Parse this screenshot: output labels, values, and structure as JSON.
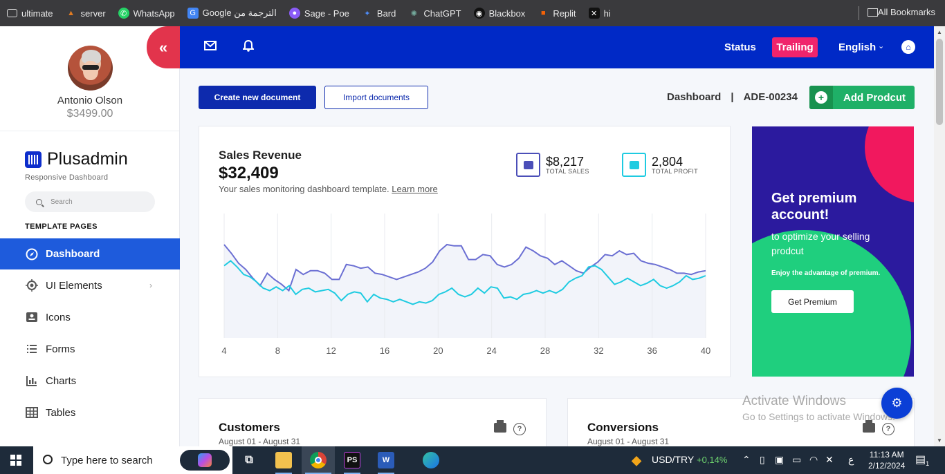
{
  "bookmarks": [
    {
      "label": "ultimate",
      "icon": "folder-icon",
      "color": "#e8e8e8"
    },
    {
      "label": "server",
      "icon": "server-icon",
      "color": "#e07b22"
    },
    {
      "label": "WhatsApp",
      "icon": "whatsapp-icon",
      "color": "#25d366"
    },
    {
      "label": "Google الترجمة من",
      "icon": "google-translate-icon",
      "color": "#4285f4"
    },
    {
      "label": "Sage - Poe",
      "icon": "poe-icon",
      "color": "#8a5cf6"
    },
    {
      "label": "Bard",
      "icon": "bard-icon",
      "color": "#4e8cf7"
    },
    {
      "label": "ChatGPT",
      "icon": "chatgpt-icon",
      "color": "#74aa9c"
    },
    {
      "label": "Blackbox",
      "icon": "blackbox-icon",
      "color": "#111111"
    },
    {
      "label": "Replit",
      "icon": "replit-icon",
      "color": "#f26207"
    },
    {
      "label": "hi",
      "icon": "hi-icon",
      "color": "#111111"
    }
  ],
  "all_bookmarks": "All Bookmarks",
  "user": {
    "name": "Antonio Olson",
    "balance": "$3499.00"
  },
  "brand": {
    "name": "Plusadmin",
    "tagline": "Responsive Dashboard"
  },
  "search": {
    "placeholder": "Search"
  },
  "template_pages_title": "TEMPLATE PAGES",
  "nav": [
    {
      "label": "Dashboard",
      "icon": "compass-icon",
      "active": true
    },
    {
      "label": "UI Elements",
      "icon": "target-icon",
      "has_submenu": true
    },
    {
      "label": "Icons",
      "icon": "id-card-icon"
    },
    {
      "label": "Forms",
      "icon": "list-icon"
    },
    {
      "label": "Charts",
      "icon": "bar-chart-icon"
    },
    {
      "label": "Tables",
      "icon": "table-icon"
    }
  ],
  "topbar": {
    "status": "Status",
    "trailing": "Trailing",
    "language": "English"
  },
  "actions": {
    "create": "Create new document",
    "import": "Import documents",
    "crumb_page": "Dashboard",
    "crumb_sep": "|",
    "crumb_id": "ADE-00234",
    "add_product": "Add Prodcut"
  },
  "sales": {
    "title": "Sales Revenue",
    "amount": "$32,409",
    "subtitle": "Your sales monitoring dashboard template.",
    "learn_more": "Learn more",
    "total_sales_value": "$8,217",
    "total_sales_label": "TOTAL SALES",
    "total_profit_value": "2,804",
    "total_profit_label": "TOTAL PROFIT"
  },
  "chart_data": {
    "type": "line",
    "x_ticks": [
      4,
      8,
      12,
      16,
      20,
      24,
      28,
      32,
      36,
      40
    ],
    "xlim": [
      4,
      40
    ],
    "ylim": [
      0,
      100
    ],
    "grid": true,
    "series": [
      {
        "color": "#6b6fd3",
        "values": [
          75,
          68,
          60,
          55,
          48,
          42,
          52,
          47,
          43,
          38,
          55,
          51,
          54,
          54,
          52,
          47,
          47,
          59,
          58,
          56,
          57,
          52,
          51,
          49,
          47,
          49,
          51,
          53,
          56,
          61,
          70,
          75,
          74,
          74,
          63,
          63,
          67,
          66,
          59,
          57,
          59,
          64,
          73,
          70,
          66,
          64,
          59,
          62,
          58,
          54,
          52,
          57,
          61,
          67,
          66,
          70,
          67,
          68,
          62,
          60,
          59,
          57,
          55,
          52,
          52,
          51,
          53,
          54
        ]
      },
      {
        "color": "#1ecbe1",
        "values": [
          58,
          62,
          57,
          51,
          49,
          45,
          40,
          38,
          41,
          38,
          42,
          35,
          39,
          40,
          37,
          38,
          39,
          36,
          30,
          35,
          37,
          36,
          29,
          35,
          32,
          31,
          29,
          31,
          29,
          27,
          29,
          28,
          30,
          35,
          37,
          40,
          35,
          33,
          35,
          40,
          36,
          41,
          40,
          32,
          33,
          31,
          35,
          36,
          38,
          36,
          38,
          36,
          39,
          45,
          48,
          50,
          57,
          58,
          55,
          49,
          43,
          45,
          48,
          45,
          42,
          44,
          47,
          42,
          40,
          42,
          45,
          50,
          47,
          48,
          50
        ]
      }
    ]
  },
  "promo": {
    "title": "Get premium account!",
    "line1": "to optimize your selling prodcut",
    "line2": "Enjoy the advantage of premium.",
    "button": "Get Premium"
  },
  "customers": {
    "title": "Customers",
    "range": "August 01 - August 31"
  },
  "conversions": {
    "title": "Conversions",
    "range": "August 01 - August 31"
  },
  "watermark": {
    "line1": "Activate Windows",
    "line2": "Go to Settings to activate Windows."
  },
  "taskbar": {
    "search_placeholder": "Type here to search",
    "ticker_label": "USD/TRY",
    "ticker_change": "+0,14%",
    "lang": "ع",
    "time": "11:13 AM",
    "date": "2/12/2024",
    "notifications": "1"
  }
}
